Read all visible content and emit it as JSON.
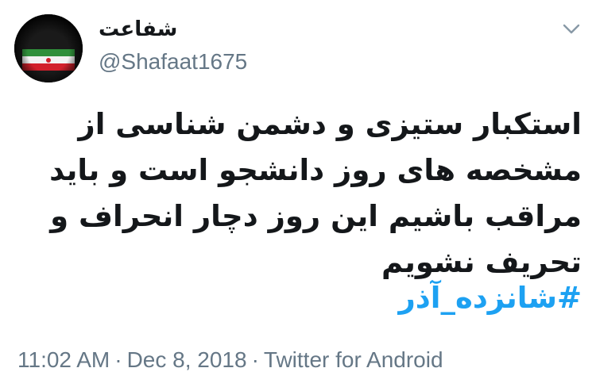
{
  "tweet": {
    "display_name": "شفاعت",
    "handle": "@Shafaat1675",
    "text": "استکبار ستیزی و دشمن شناسی از مشخصه های روز دانشجو است و باید مراقب باشیم این روز دچار انحراف و تحریف نشویم",
    "hashtag": "#شانزده_آذر",
    "time": "11:02 AM",
    "date": "Dec 8, 2018",
    "source": "Twitter for Android",
    "separator": "·"
  },
  "icons": {
    "avatar": "iran-flag-avatar",
    "menu": "chevron-down-icon"
  },
  "colors": {
    "text": "#14171a",
    "secondary": "#657786",
    "link": "#1da1f2"
  }
}
